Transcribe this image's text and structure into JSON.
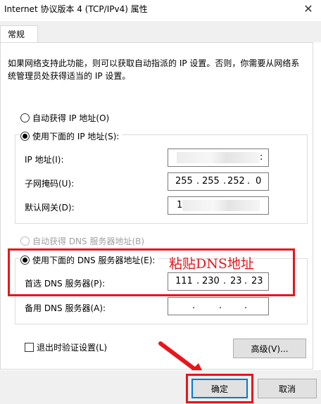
{
  "window": {
    "title": "Internet 协议版本 4 (TCP/IPv4) 属性",
    "close_glyph": "✕"
  },
  "tabs": [
    {
      "label": "常规"
    }
  ],
  "intro_text": "如果网络支持此功能，则可以获取自动指派的 IP 设置。否则，你需要从网络系统管理员处获得适当的 IP 设置。",
  "ip_section": {
    "auto_label": "自动获得 IP 地址(O)",
    "manual_label": "使用下面的 IP 地址(S):",
    "auto_checked": false,
    "manual_checked": true,
    "fields": {
      "ip_address": {
        "label": "IP 地址(I):",
        "value_visible": ":"
      },
      "subnet_mask": {
        "label": "子网掩码(U):",
        "octets": [
          "255",
          "255",
          "252",
          "0"
        ]
      },
      "gateway": {
        "label": "默认网关(D):",
        "value_visible": "1"
      }
    }
  },
  "dns_section": {
    "auto_label": "自动获得 DNS 服务器地址(B)",
    "manual_label": "使用下面的 DNS 服务器地址(E):",
    "auto_enabled": false,
    "manual_checked": true,
    "preferred": {
      "label": "首选 DNS 服务器(P):",
      "octets": [
        "111",
        "230",
        "23",
        "23"
      ]
    },
    "alternate": {
      "label": "备用 DNS 服务器(A):",
      "octets": [
        "",
        "",
        "",
        ""
      ]
    }
  },
  "dot": ".",
  "validate_label": "退出时验证设置(L)",
  "buttons": {
    "advanced": "高级(V)...",
    "ok": "确定",
    "cancel": "取消"
  },
  "annotation": {
    "text": "粘贴DNS地址",
    "color": "#e8151b"
  }
}
